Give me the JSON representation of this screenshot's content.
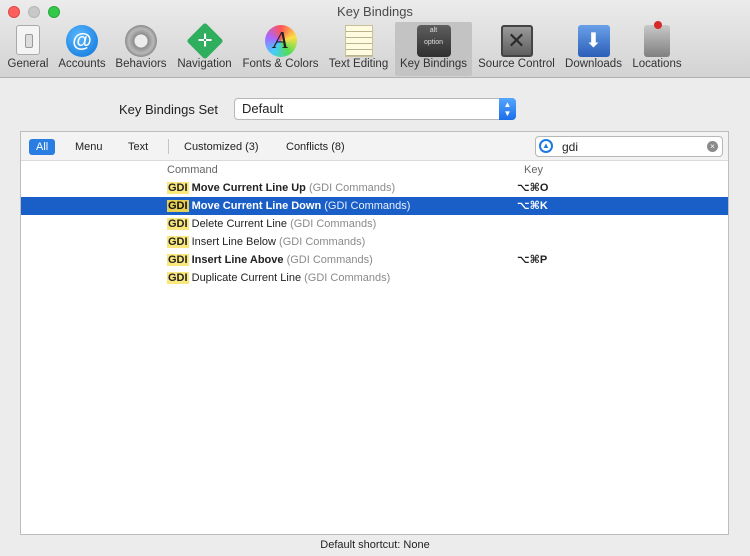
{
  "window": {
    "title": "Key Bindings"
  },
  "toolbar": {
    "items": [
      {
        "label": "General",
        "icon": "general-switch-icon"
      },
      {
        "label": "Accounts",
        "icon": "at-sign-icon"
      },
      {
        "label": "Behaviors",
        "icon": "gear-icon"
      },
      {
        "label": "Navigation",
        "icon": "navigation-arrows-icon"
      },
      {
        "label": "Fonts & Colors",
        "icon": "font-color-wheel-icon"
      },
      {
        "label": "Text Editing",
        "icon": "text-page-pencil-icon"
      },
      {
        "label": "Key Bindings",
        "icon": "keyboard-key-icon",
        "selected": true
      },
      {
        "label": "Source Control",
        "icon": "source-control-box-icon"
      },
      {
        "label": "Downloads",
        "icon": "downloads-tray-icon"
      },
      {
        "label": "Locations",
        "icon": "joystick-drive-icon"
      }
    ],
    "at_glyph": "@",
    "fonts_glyph": "A",
    "key_glyph_top": "alt",
    "key_glyph_bottom": "option"
  },
  "key_bindings_set": {
    "label": "Key Bindings Set",
    "value": "Default",
    "stepper_up": "▲",
    "stepper_down": "▼"
  },
  "filters": [
    {
      "label": "All",
      "active": true
    },
    {
      "label": "Menu"
    },
    {
      "label": "Text"
    },
    {
      "label": "Customized (3)"
    },
    {
      "label": "Conflicts (8)"
    }
  ],
  "search": {
    "value": "gdi",
    "clear_glyph": "×"
  },
  "columns": {
    "command": "Command",
    "key": "Key"
  },
  "bindings": [
    {
      "prefix": "GDI",
      "name": " Move Current Line Up",
      "group": " (GDI Commands)",
      "key": "⌥⌘O",
      "bold": true,
      "selected": false
    },
    {
      "prefix": "GDI",
      "name": " Move Current Line Down",
      "group": " (GDI Commands)",
      "key": "⌥⌘K",
      "bold": true,
      "selected": true
    },
    {
      "prefix": "GDI",
      "name": " Delete Current Line",
      "group": " (GDI Commands)",
      "key": "",
      "bold": false,
      "selected": false
    },
    {
      "prefix": "GDI",
      "name": " Insert Line Below",
      "group": " (GDI Commands)",
      "key": "",
      "bold": false,
      "selected": false
    },
    {
      "prefix": "GDI",
      "name": " Insert Line Above",
      "group": " (GDI Commands)",
      "key": "⌥⌘P",
      "bold": true,
      "selected": false
    },
    {
      "prefix": "GDI",
      "name": " Duplicate Current Line",
      "group": " (GDI Commands)",
      "key": "",
      "bold": false,
      "selected": false
    }
  ],
  "status": {
    "default_shortcut": "Default shortcut: None"
  },
  "colors": {
    "accent": "#2a7de1",
    "selection": "#1a5fc7",
    "highlight": "#fbe87d"
  }
}
